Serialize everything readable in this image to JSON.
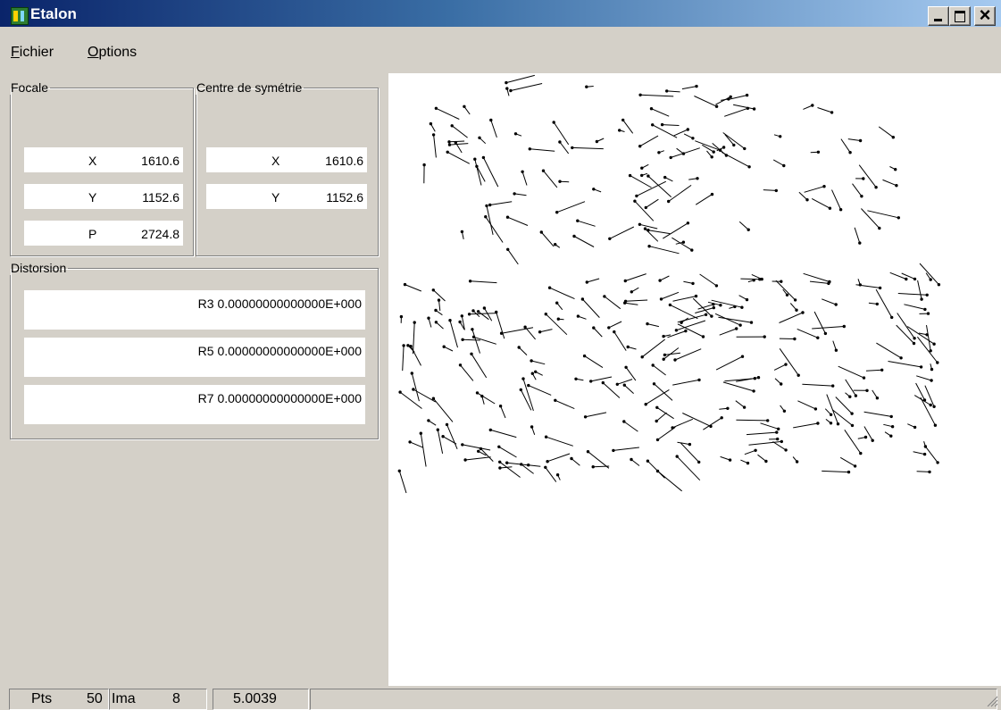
{
  "window": {
    "title": "Etalon"
  },
  "menu": {
    "fichier_first": "F",
    "fichier_rest": "ichier",
    "options_first": "O",
    "options_rest": "ptions"
  },
  "focale": {
    "legend": "Focale",
    "x_label": "X",
    "x_value": "1610.6",
    "y_label": "Y",
    "y_value": "1152.6",
    "p_label": "P",
    "p_value": "2724.8"
  },
  "centre": {
    "legend": "Centre de symétrie",
    "x_label": "X",
    "x_value": "1610.6",
    "y_label": "Y",
    "y_value": "1152.6"
  },
  "distorsion": {
    "legend": "Distorsion",
    "r3": "R3 0.00000000000000E+000",
    "r5": "R5 0.00000000000000E+000",
    "r7": "R7 0.00000000000000E+000"
  },
  "status": {
    "pts_label": "Pts",
    "pts_value": "50",
    "ima_label": "Ima",
    "ima_value": "8",
    "value": "5.0039"
  }
}
